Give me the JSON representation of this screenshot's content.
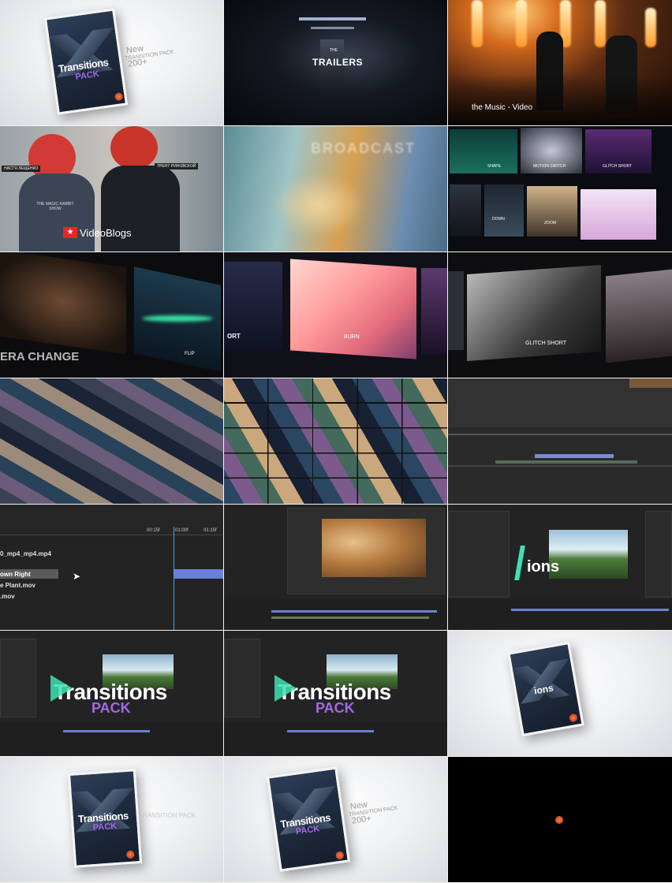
{
  "tiles": {
    "t1": {
      "box_title_1": "Transitions",
      "box_title_2": "PACK",
      "new": "New",
      "transition_pack": "TRANSITION PACK",
      "count": "200+"
    },
    "t2": {
      "the": "THE",
      "trailers": "TRAILERS"
    },
    "t3": {
      "caption": "the Music - Video"
    },
    "t4": {
      "name_left": "НАСТЯ ЛЕЩЕНКО",
      "name_right": "ТРЕНТ РИНОВСКОЙ",
      "caption": "VideoBlogs",
      "shirt": "THE MAGIC RABBIT SHOW"
    },
    "t5": {
      "word": "BROADCAST"
    },
    "t6": {
      "labels": [
        "SHAPE",
        "MOTION SWITCH",
        "GLITCH SHORT",
        "DOWN",
        "ZOOM"
      ]
    },
    "t7": {
      "caption": "ERA CHANGE",
      "flip": "FLIP"
    },
    "t8": {
      "left": "ORT",
      "burn": "BURN"
    },
    "t9": {
      "caption": "GLITCH SHORT"
    },
    "t13": {
      "times": [
        "00:15f",
        "01:00f",
        "01:15f"
      ],
      "layers": [
        "0_mp4_mp4.mp4",
        "own Right",
        "e Plant.mov",
        ".mov"
      ]
    },
    "t15": {
      "word": "ions"
    },
    "t16": {
      "title1": "Transitions",
      "title2": "PACK"
    },
    "t17": {
      "title1": "Transitions",
      "title2": "PACK"
    },
    "t18": {
      "word": "ions"
    },
    "t19": {
      "title1": "Transitions",
      "title2": "PACK",
      "ghost": "TRANSITION PACK"
    },
    "t20": {
      "title1": "Transitions",
      "title2": "PACK",
      "new": "New",
      "transition_pack": "TRANSITION PACK",
      "count": "200+"
    }
  },
  "colors": {
    "purple": "#a766e8",
    "teal": "#3ee0b0",
    "red": "#e8242b",
    "orange": "#ff8c2e"
  }
}
